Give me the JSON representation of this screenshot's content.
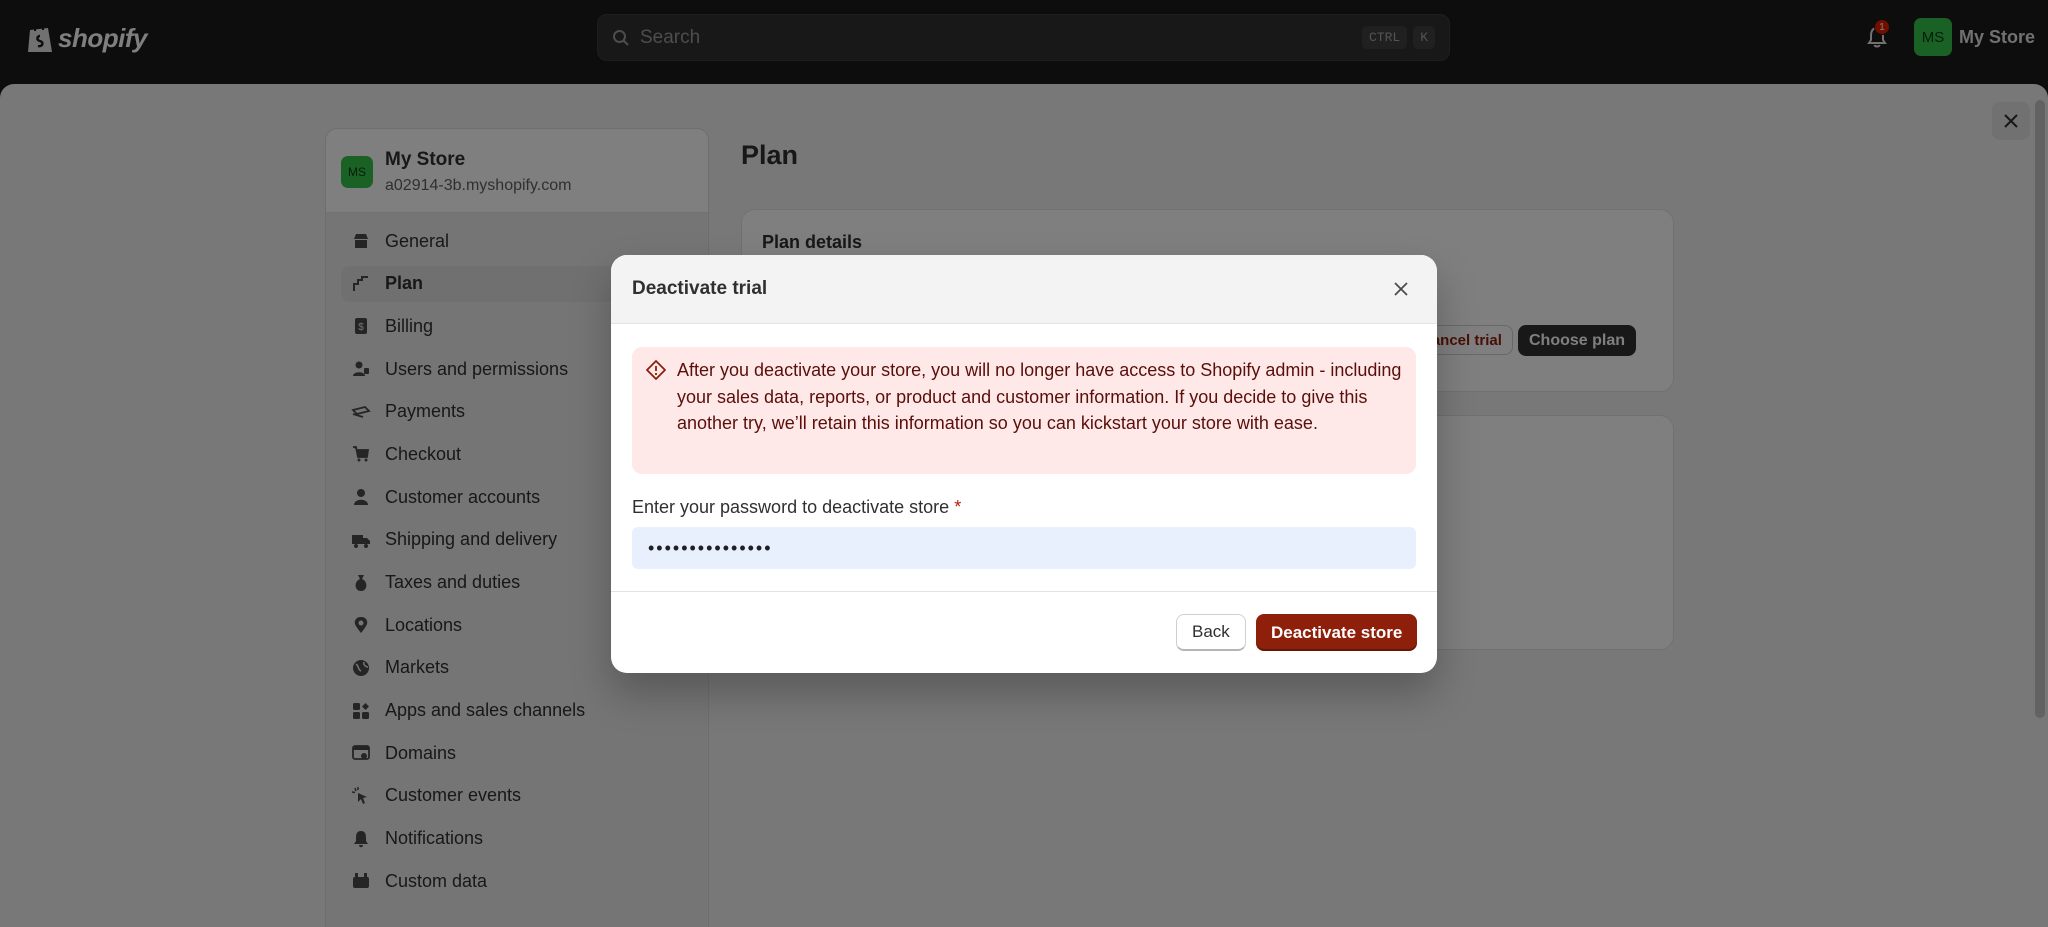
{
  "topbar": {
    "logo_text": "shopify",
    "search_placeholder": "Search",
    "shortcut_key1": "CTRL",
    "shortcut_key2": "K",
    "notification_count": "1",
    "user_initials": "MS",
    "user_name": "My Store"
  },
  "sidebar": {
    "store_initials": "MS",
    "store_name": "My Store",
    "store_domain": "a02914-3b.myshopify.com",
    "items": [
      {
        "label": "General",
        "icon": "store-icon"
      },
      {
        "label": "Plan",
        "icon": "plan-icon",
        "active": true
      },
      {
        "label": "Billing",
        "icon": "receipt-icon"
      },
      {
        "label": "Users and permissions",
        "icon": "users-icon"
      },
      {
        "label": "Payments",
        "icon": "payments-icon"
      },
      {
        "label": "Checkout",
        "icon": "cart-icon"
      },
      {
        "label": "Customer accounts",
        "icon": "person-icon"
      },
      {
        "label": "Shipping and delivery",
        "icon": "truck-icon"
      },
      {
        "label": "Taxes and duties",
        "icon": "tax-icon"
      },
      {
        "label": "Locations",
        "icon": "location-pin-icon"
      },
      {
        "label": "Markets",
        "icon": "globe-icon"
      },
      {
        "label": "Apps and sales channels",
        "icon": "apps-icon"
      },
      {
        "label": "Domains",
        "icon": "domain-icon"
      },
      {
        "label": "Customer events",
        "icon": "cursor-icon"
      },
      {
        "label": "Notifications",
        "icon": "bell-icon"
      },
      {
        "label": "Custom data",
        "icon": "database-icon"
      }
    ]
  },
  "main": {
    "title": "Plan",
    "plan_card_title": "Plan details",
    "cancel_trial_label": "Cancel trial",
    "choose_plan_label": "Choose plan"
  },
  "modal": {
    "title": "Deactivate trial",
    "banner_text": "After you deactivate your store, you will no longer have access to Shopify admin - including your sales data, reports, or product and customer information. If you decide to give this another try, we’ll retain this information so you can kickstart your store with ease.",
    "password_label": "Enter your password to deactivate store",
    "required_mark": "*",
    "password_value": "•••••••••••••••",
    "back_label": "Back",
    "deactivate_label": "Deactivate store"
  },
  "colors": {
    "critical": "#8e1f0b",
    "banner_bg": "#fee9e8",
    "avatar_green": "#35c24a"
  }
}
